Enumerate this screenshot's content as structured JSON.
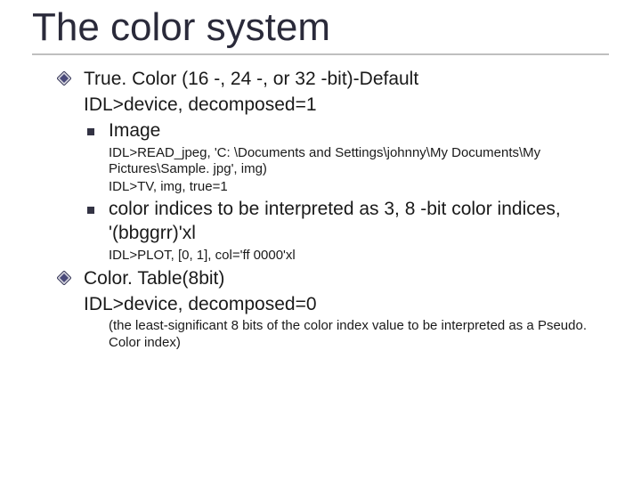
{
  "title": "The color system",
  "items": {
    "truecolor": {
      "heading": "True. Color (16 -, 24 -, or 32 -bit)-Default",
      "device_line": "IDL>device, decomposed=1",
      "image_label": "Image",
      "image_code1": "IDL>READ_jpeg, 'C: \\Documents and Settings\\johnny\\My Documents\\My Pictures\\Sample. jpg', img)",
      "image_code2": "IDL>TV, img, true=1",
      "indices_text": "color indices to be interpreted as 3, 8 -bit color indices, '(bbggrr)'xl",
      "plot_code": "IDL>PLOT, [0, 1], col='ff 0000'xl"
    },
    "colortable": {
      "heading": "Color. Table(8bit)",
      "device_line": "IDL>device, decomposed=0",
      "note": "(the least-significant 8 bits of the color index value to be interpreted as a Pseudo. Color index)"
    }
  }
}
